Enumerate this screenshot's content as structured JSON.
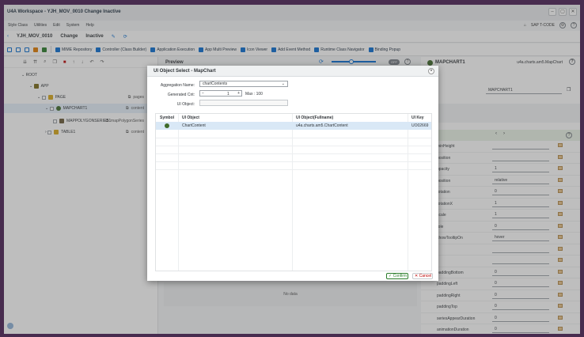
{
  "window": {
    "title": "U4A Workspace - YJH_MOV_0010 Change Inactive",
    "buttons": [
      "–",
      "▢",
      "✕"
    ]
  },
  "menubar": {
    "items": [
      "Style Class",
      "Utilities",
      "Edit",
      "System",
      "Help"
    ],
    "right_code": "SAP T-CODE"
  },
  "header": {
    "app_id": "YJH_MOV_0010",
    "mode": "Change",
    "status": "Inactive"
  },
  "toolbar": {
    "items": [
      "MIME Repository",
      "Controller (Class Builder)",
      "Application Execution",
      "App Multi Preview",
      "Icon Viewer",
      "Add Event Method",
      "Runtime Class Navigator",
      "Binding Popup"
    ]
  },
  "tree": {
    "rows": [
      {
        "label": "ROOT",
        "agg": ""
      },
      {
        "label": "APP",
        "agg": ""
      },
      {
        "label": "PAGE",
        "agg": "pages"
      },
      {
        "label": "MAPCHART1",
        "agg": "content"
      },
      {
        "label": "MAPPOLYGONSERIES1",
        "agg": "mapPolygonSeries"
      },
      {
        "label": "TABLE1",
        "agg": "content"
      }
    ]
  },
  "preview": {
    "title": "Preview",
    "toggle": "OFF",
    "no_data": "No data"
  },
  "right_panel": {
    "title": "MAPCHART1",
    "class_name": "u4a.charts.am5.MapChart",
    "id_value": "MAPCHART1",
    "properties": [
      {
        "name": "minHeight",
        "value": ""
      },
      {
        "name": "position",
        "value": ""
      },
      {
        "name": "opacity",
        "value": "1"
      },
      {
        "name": "position",
        "value": "relative"
      },
      {
        "name": "rotation",
        "value": "0"
      },
      {
        "name": "rotationX",
        "value": "1"
      },
      {
        "name": "scale",
        "value": "1"
      },
      {
        "name": "role",
        "value": "0"
      },
      {
        "name": "showTooltipOn",
        "value": "hover"
      },
      {
        "name": "",
        "value": ""
      },
      {
        "name": "",
        "value": ""
      },
      {
        "name": "paddingBottom",
        "value": "0"
      },
      {
        "name": "paddingLeft",
        "value": "0"
      },
      {
        "name": "paddingRight",
        "value": "0"
      },
      {
        "name": "paddingTop",
        "value": "0"
      },
      {
        "name": "seriesAppearDuration",
        "value": "0"
      },
      {
        "name": "animationDuration",
        "value": "0"
      }
    ]
  },
  "dialog": {
    "title": "UI Object Select - MapChart",
    "aggregation_label": "Aggregation Name:",
    "aggregation_value": "chartContents",
    "generated_label": "Generated Cnt:",
    "generated_value": "1",
    "max_text": "Max : 100",
    "uiobject_label": "UI Object:",
    "columns": [
      "Symbol",
      "UI Object",
      "UI Object(Fullname)",
      "UI Key"
    ],
    "rows": [
      {
        "ui_object": "ChartContent",
        "fullname": "u4a.charts.am5.ChartContent",
        "key": "UO02669"
      }
    ],
    "confirm": "Confirm",
    "cancel": "Cancel"
  }
}
